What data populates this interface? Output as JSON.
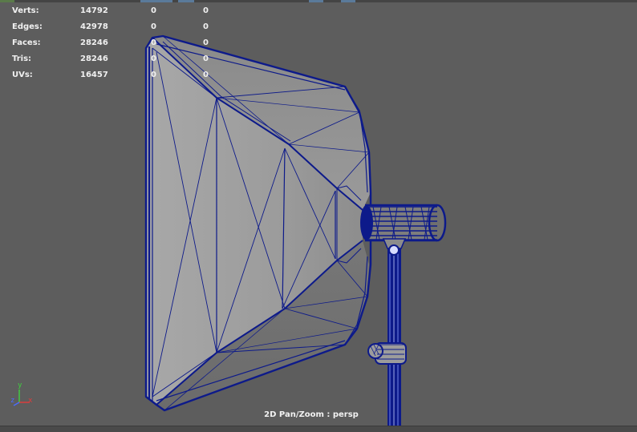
{
  "heads_up_display": {
    "rows": [
      {
        "label": "Verts:",
        "total": "14792",
        "selected": "0",
        "components": "0"
      },
      {
        "label": "Edges:",
        "total": "42978",
        "selected": "0",
        "components": "0"
      },
      {
        "label": "Faces:",
        "total": "28246",
        "selected": "0",
        "components": "0"
      },
      {
        "label": "Tris:",
        "total": "28246",
        "selected": "0",
        "components": "0"
      },
      {
        "label": "UVs:",
        "total": "16457",
        "selected": "0",
        "components": "0"
      }
    ]
  },
  "axis_gizmo": {
    "x_label": "x",
    "y_label": "y",
    "z_label": "z",
    "x_color": "#e23b3b",
    "y_color": "#3fd23f",
    "z_color": "#4a6cff"
  },
  "viewport": {
    "camera_label": "2D Pan/Zoom : persp",
    "background_color": "#5d5d5d",
    "wireframe_color": "#0d1a8a",
    "shading_color": "#a9a9a9"
  },
  "scene_object": {
    "name_icon": "softbox-light-icon"
  }
}
